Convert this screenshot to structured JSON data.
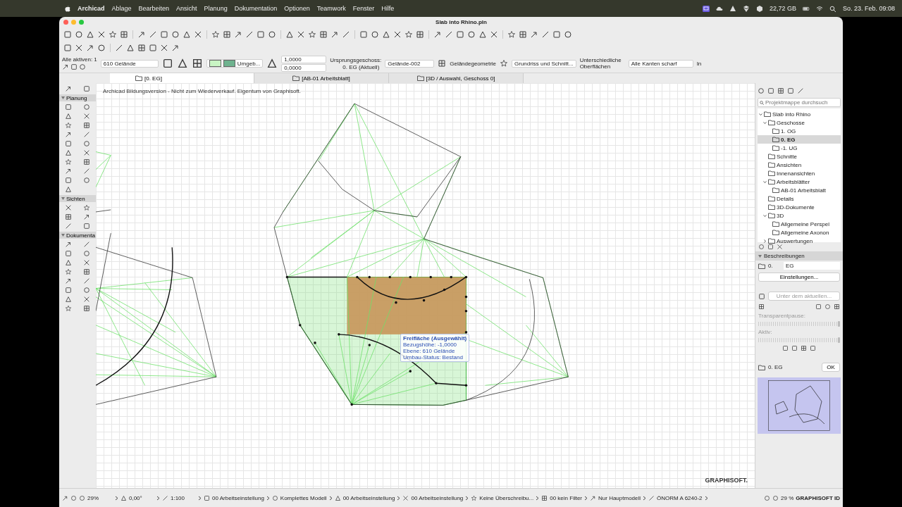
{
  "menubar": {
    "app": "Archicad",
    "menus": [
      "Ablage",
      "Bearbeiten",
      "Ansicht",
      "Planung",
      "Dokumentation",
      "Optionen",
      "Teamwork",
      "Fenster",
      "Hilfe"
    ],
    "storage": "22,72 GB",
    "clock": "So. 23. Feb. 09:08"
  },
  "window": {
    "title": "Slab into Rhino.pln"
  },
  "infobox": {
    "selection": "Alle aktiven: 1",
    "layer": "610 Gelände",
    "surface": "Umgeb...",
    "values": [
      "1,0000",
      "0,0000"
    ],
    "origin_label": "Ursprungsgeschoss:",
    "origin_value": "0. EG (Aktuell)",
    "id": "Gelände-002",
    "geometry": "Geländegeometrie",
    "display": "Grundriss und Schnitt...",
    "surfaces": "Unterschiedliche Oberflächen",
    "edges": "Alle Kanten scharf",
    "cut_text": "In"
  },
  "tabs": [
    {
      "label": "[0. EG]",
      "selected": true
    },
    {
      "label": "[AB-01 Arbeitsblatt]",
      "selected": false
    },
    {
      "label": "[3D / Auswahl, Geschoss 0]",
      "selected": false
    }
  ],
  "toolbox": {
    "sections": [
      {
        "title": "Planung"
      },
      {
        "title": "Sichten"
      },
      {
        "title": "Dokumenta"
      }
    ]
  },
  "canvas": {
    "watermark": "Archicad Bildungsversion - Nicht zum Wiederverkauf. Eigentum von Graphisoft.",
    "tooltip": [
      "Freifläche (Ausgewählt)",
      "Bezugshöhe: -1,0000",
      "Ebene: 610 Gelände",
      "Umbau-Status: Bestand"
    ],
    "logo": "GRAPHISOFT."
  },
  "navigator": {
    "search_placeholder": "Projektmappe durchsuch",
    "tree": [
      {
        "label": "Slab into Rhino",
        "selected": false,
        "expanded": true,
        "children": [
          {
            "label": "Geschosse",
            "selected": false,
            "expanded": true,
            "children": [
              {
                "label": "1. OG",
                "selected": false
              },
              {
                "label": "0. EG",
                "selected": true
              },
              {
                "label": "-1. UG",
                "selected": false
              }
            ]
          },
          {
            "label": "Schnitte",
            "selected": false
          },
          {
            "label": "Ansichten",
            "selected": false
          },
          {
            "label": "Innenansichten",
            "selected": false
          },
          {
            "label": "Arbeitsblätter",
            "selected": false,
            "expanded": true,
            "children": [
              {
                "label": "AB-01 Arbeitsblatt",
                "selected": false
              }
            ]
          },
          {
            "label": "Details",
            "selected": false
          },
          {
            "label": "3D-Dokumente",
            "selected": false
          },
          {
            "label": "3D",
            "selected": false,
            "expanded": true,
            "children": [
              {
                "label": "Allgemeine Perspel",
                "selected": false
              },
              {
                "label": "Allgemeine Axonon",
                "selected": false
              }
            ]
          },
          {
            "label": "Auswertungen",
            "selected": false,
            "expanded": false
          }
        ]
      }
    ]
  },
  "description": {
    "title": "Beschreibungen",
    "number": "0.",
    "name": "EG",
    "button": "Einstellungen..."
  },
  "layers": {
    "placeholder": "Unter dem aktuellen...",
    "transparent": {
      "label": "Transparentpause:",
      "level": 1
    },
    "active": {
      "label": "Aktiv:",
      "level": 1
    }
  },
  "footer": {
    "story": "0. EG",
    "ok": "OK"
  },
  "statusbar": {
    "zoom": "29%",
    "angle": "0,00°",
    "scale": "1:100",
    "items": [
      "00 Arbeitseinstellung",
      "Komplettes Modell",
      "00 Arbeitseinstellung",
      "00 Arbeitseinstellung",
      "Keine Überschreibu...",
      "00 kein Filter",
      "Nur Hauptmodell",
      "ÖNORM A 6240-2"
    ],
    "right_zoom": "29 %",
    "account": "GRAPHISOFT ID"
  }
}
